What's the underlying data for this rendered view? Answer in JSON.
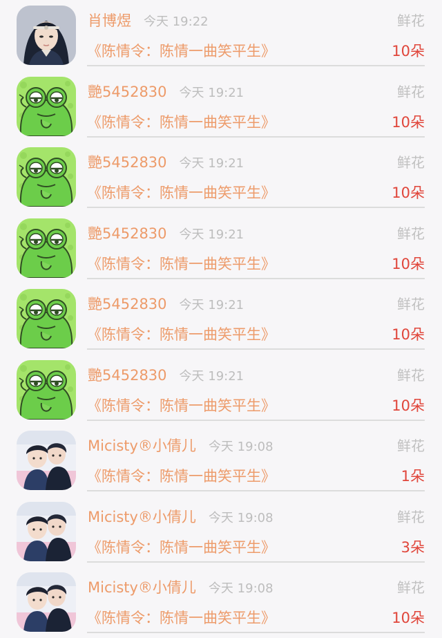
{
  "records": [
    {
      "avatar": "portrait-icon",
      "user": "肖博煜",
      "time": "今天 19:22",
      "gift": "鲜花",
      "book": "《陈情令：陈情一曲笑平生》",
      "amount": "10朵"
    },
    {
      "avatar": "frog-icon",
      "user": "艷5452830",
      "time": "今天 19:21",
      "gift": "鲜花",
      "book": "《陈情令：陈情一曲笑平生》",
      "amount": "10朵"
    },
    {
      "avatar": "frog-icon",
      "user": "艷5452830",
      "time": "今天 19:21",
      "gift": "鲜花",
      "book": "《陈情令：陈情一曲笑平生》",
      "amount": "10朵"
    },
    {
      "avatar": "frog-icon",
      "user": "艷5452830",
      "time": "今天 19:21",
      "gift": "鲜花",
      "book": "《陈情令：陈情一曲笑平生》",
      "amount": "10朵"
    },
    {
      "avatar": "frog-icon",
      "user": "艷5452830",
      "time": "今天 19:21",
      "gift": "鲜花",
      "book": "《陈情令：陈情一曲笑平生》",
      "amount": "10朵"
    },
    {
      "avatar": "frog-icon",
      "user": "艷5452830",
      "time": "今天 19:21",
      "gift": "鲜花",
      "book": "《陈情令：陈情一曲笑平生》",
      "amount": "10朵"
    },
    {
      "avatar": "two-people-icon",
      "user": "Micisty®小倩儿",
      "time": "今天 19:08",
      "gift": "鲜花",
      "book": "《陈情令：陈情一曲笑平生》",
      "amount": "1朵"
    },
    {
      "avatar": "two-people-icon",
      "user": "Micisty®小倩儿",
      "time": "今天 19:08",
      "gift": "鲜花",
      "book": "《陈情令：陈情一曲笑平生》",
      "amount": "3朵"
    },
    {
      "avatar": "two-people-icon",
      "user": "Micisty®小倩儿",
      "time": "今天 19:08",
      "gift": "鲜花",
      "book": "《陈情令：陈情一曲笑平生》",
      "amount": "10朵"
    }
  ]
}
